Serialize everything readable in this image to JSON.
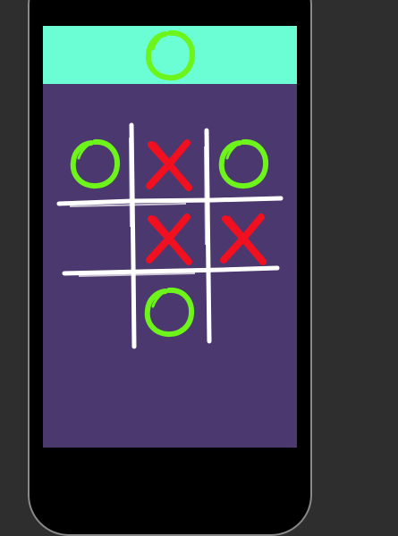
{
  "colors": {
    "background": "#2e2e2e",
    "phone_frame": "#000000",
    "screen": "#4b386e",
    "turn_bar": "#6bfdd3",
    "o_mark": "#6df41a",
    "x_mark": "#f0101f",
    "grid_lines": "#ffffff"
  },
  "turn_indicator": {
    "mark": "O",
    "icon": "circle-icon"
  },
  "board": {
    "cells": [
      [
        "O",
        "X",
        "O"
      ],
      [
        "",
        "X",
        "X"
      ],
      [
        "",
        "O",
        ""
      ]
    ]
  }
}
